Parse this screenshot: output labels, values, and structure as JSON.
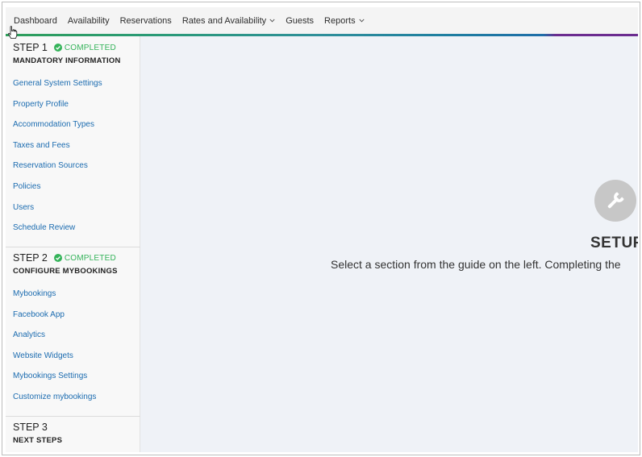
{
  "nav": {
    "items": [
      {
        "label": "Dashboard",
        "dropdown": false
      },
      {
        "label": "Availability",
        "dropdown": false
      },
      {
        "label": "Reservations",
        "dropdown": false
      },
      {
        "label": "Rates and Availability",
        "dropdown": true
      },
      {
        "label": "Guests",
        "dropdown": false
      },
      {
        "label": "Reports",
        "dropdown": true
      }
    ]
  },
  "sidebar": {
    "step1": {
      "label": "STEP 1",
      "status": "COMPLETED",
      "subtitle": "MANDATORY INFORMATION",
      "links": [
        "General System Settings",
        "Property Profile",
        "Accommodation Types",
        "Taxes and Fees",
        "Reservation Sources",
        "Policies",
        "Users",
        "Schedule Review"
      ]
    },
    "step2": {
      "label": "STEP 2",
      "status": "COMPLETED",
      "subtitle": "CONFIGURE MYBOOKINGS",
      "links": [
        "Mybookings",
        "Facebook App",
        "Analytics",
        "Website Widgets",
        "Mybookings Settings",
        "Customize mybookings"
      ]
    },
    "step3": {
      "label": "STEP 3",
      "subtitle": "NEXT STEPS"
    }
  },
  "main": {
    "title": "SETUP",
    "text": "Select a section from the guide on the left. Completing the"
  },
  "colors": {
    "link": "#1c6cb0",
    "completed": "#35b35a",
    "main_bg": "#eff2f7",
    "accent_end": "#6b2c8f"
  }
}
